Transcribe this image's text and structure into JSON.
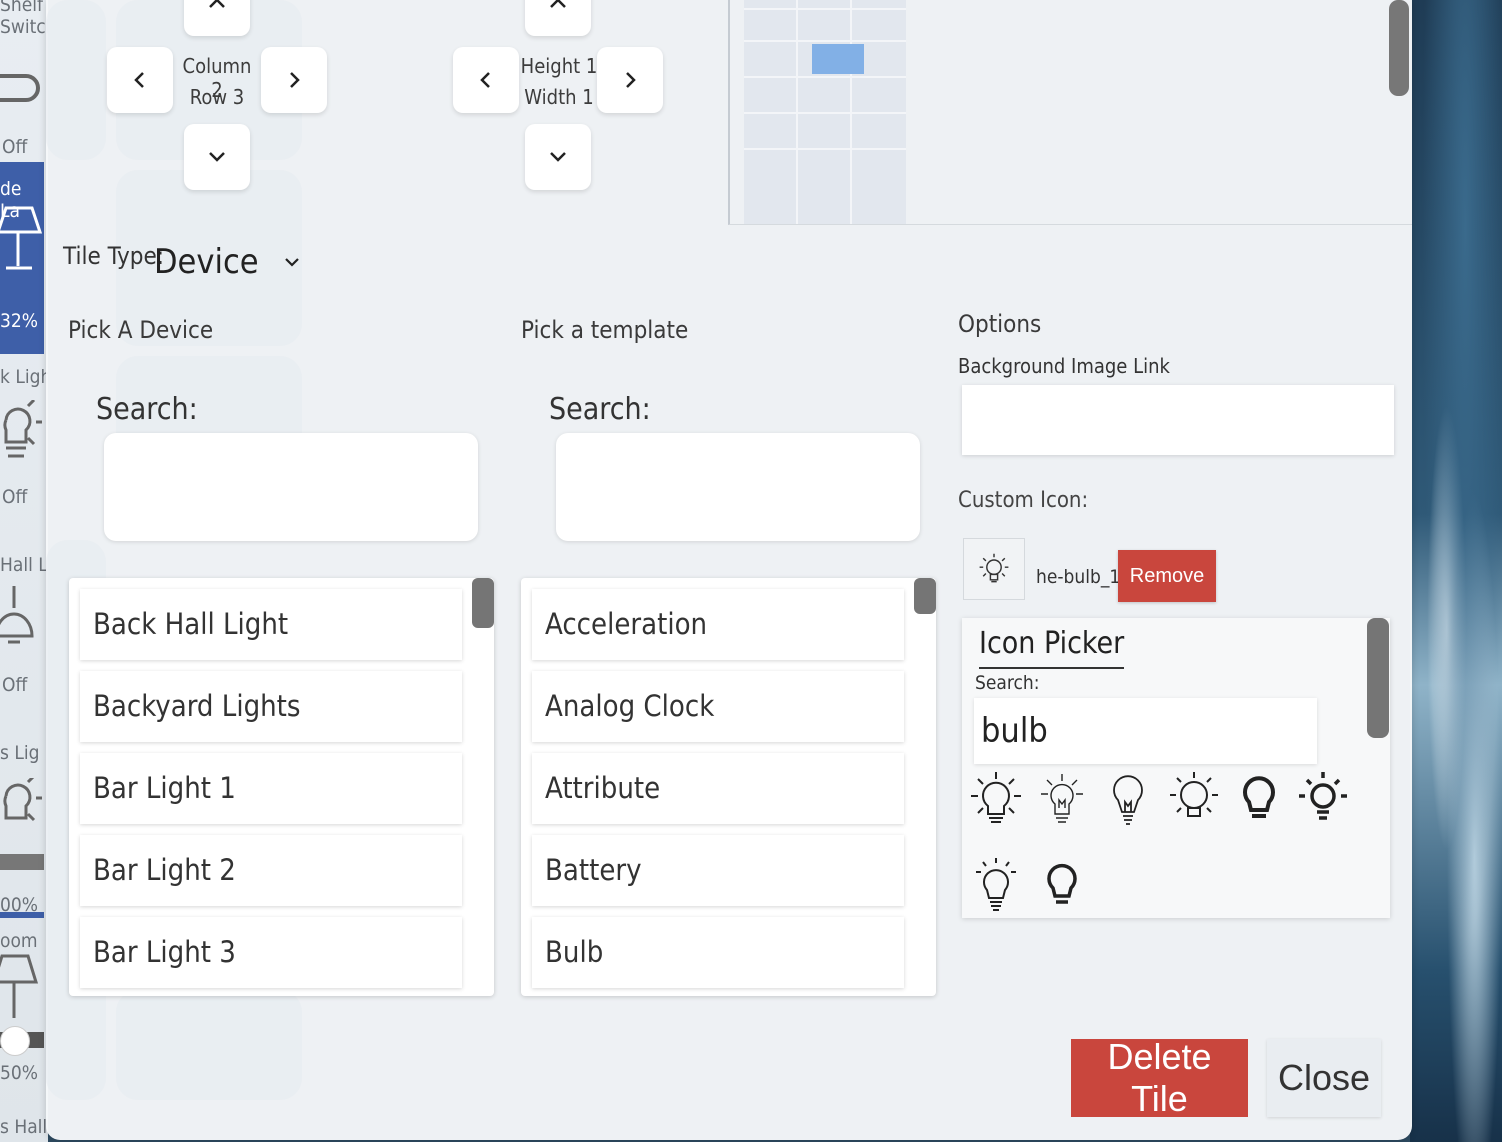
{
  "background": {
    "left_labels": [
      "Shelf",
      "Switch",
      "Off",
      "de La",
      "32%",
      "k Ligh",
      "Off",
      "Hall Li",
      "Off",
      "s Lig",
      "00%",
      "oom",
      "50%",
      "s Hall"
    ]
  },
  "position": {
    "column_label": "Column 2",
    "row_label": "Row 3",
    "height_label": "Height 1",
    "width_label": "Width 1"
  },
  "tile_type": {
    "label": "Tile Type:",
    "value": "Device"
  },
  "device_picker": {
    "title": "Pick A Device",
    "search_label": "Search:",
    "search_value": "",
    "items": [
      "Back Hall Light",
      "Backyard Lights",
      "Bar Light 1",
      "Bar Light 2",
      "Bar Light 3"
    ]
  },
  "template_picker": {
    "title": "Pick a template",
    "search_label": "Search:",
    "search_value": "",
    "items": [
      "Acceleration",
      "Analog Clock",
      "Attribute",
      "Battery",
      "Bulb"
    ]
  },
  "options": {
    "title": "Options",
    "bg_image_label": "Background Image Link",
    "bg_image_value": "",
    "custom_icon_label": "Custom Icon:",
    "custom_icon_name": "he-bulb_1",
    "remove_label": "Remove"
  },
  "icon_picker": {
    "title": "Icon Picker",
    "search_label": "Search:",
    "search_value": "bulb",
    "icons": [
      "bulb-rays-icon",
      "bulb-rays-thin-icon",
      "bulb-outline-icon",
      "bulb-rays-round-icon",
      "bulb-solid-icon",
      "bulb-rays-bold-icon",
      "bulb-rays-top-icon",
      "bulb-bold-outline-icon"
    ]
  },
  "footer": {
    "delete_label": "Delete Tile",
    "close_label": "Close"
  },
  "colors": {
    "danger": "#c9463d",
    "grid_selected": "#82b0e6",
    "dashboard_accent": "#3e5fa8"
  }
}
